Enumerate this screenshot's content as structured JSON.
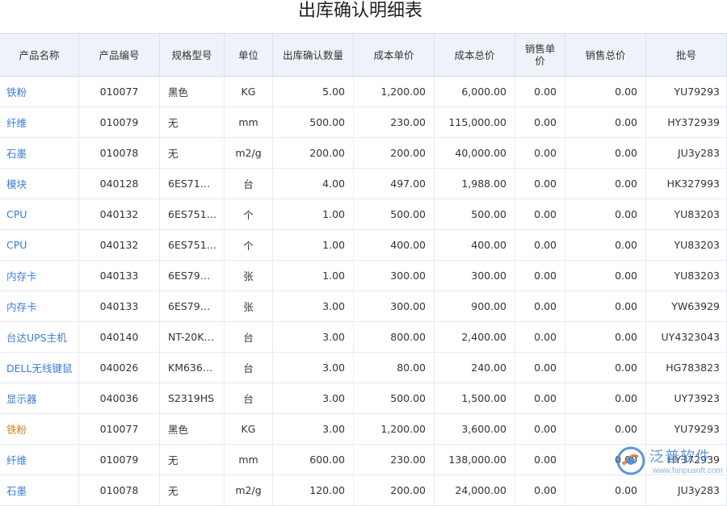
{
  "title": "出库确认明细表",
  "headers": {
    "name": "产品名称",
    "code": "产品编号",
    "spec": "规格型号",
    "unit": "单位",
    "qty": "出库确认数量",
    "unit_cost": "成本单价",
    "total_cost": "成本总价",
    "sale_price": "销售单价",
    "sale_total": "销售总价",
    "batch": "批号"
  },
  "rows": [
    {
      "name": "铁粉",
      "code": "010077",
      "spec": "黑色",
      "unit": "KG",
      "qty": "5.00",
      "unit_cost": "1,200.00",
      "total_cost": "6,000.00",
      "sale_price": "0.00",
      "sale_total": "0.00",
      "batch": "YU79293"
    },
    {
      "name": "纤维",
      "code": "010079",
      "spec": "无",
      "unit": "mm",
      "qty": "500.00",
      "unit_cost": "230.00",
      "total_cost": "115,000.00",
      "sale_price": "0.00",
      "sale_total": "0.00",
      "batch": "HY372939"
    },
    {
      "name": "石墨",
      "code": "010078",
      "spec": "无",
      "unit": "m2/g",
      "qty": "200.00",
      "unit_cost": "200.00",
      "total_cost": "40,000.00",
      "sale_price": "0.00",
      "sale_total": "0.00",
      "batch": "JU3y283"
    },
    {
      "name": "模块",
      "code": "040128",
      "spec": "6ES71…",
      "unit": "台",
      "qty": "4.00",
      "unit_cost": "497.00",
      "total_cost": "1,988.00",
      "sale_price": "0.00",
      "sale_total": "0.00",
      "batch": "HK327993"
    },
    {
      "name": "CPU",
      "code": "040132",
      "spec": "6ES751…",
      "unit": "个",
      "qty": "1.00",
      "unit_cost": "500.00",
      "total_cost": "500.00",
      "sale_price": "0.00",
      "sale_total": "0.00",
      "batch": "YU83203"
    },
    {
      "name": "CPU",
      "code": "040132",
      "spec": "6ES751…",
      "unit": "个",
      "qty": "1.00",
      "unit_cost": "400.00",
      "total_cost": "400.00",
      "sale_price": "0.00",
      "sale_total": "0.00",
      "batch": "YU83203"
    },
    {
      "name": "内存卡",
      "code": "040133",
      "spec": "6ES79…",
      "unit": "张",
      "qty": "1.00",
      "unit_cost": "300.00",
      "total_cost": "300.00",
      "sale_price": "0.00",
      "sale_total": "0.00",
      "batch": "YU83203"
    },
    {
      "name": "内存卡",
      "code": "040133",
      "spec": "6ES79…",
      "unit": "张",
      "qty": "3.00",
      "unit_cost": "300.00",
      "total_cost": "900.00",
      "sale_price": "0.00",
      "sale_total": "0.00",
      "batch": "YW63929"
    },
    {
      "name": "台达UPS主机",
      "code": "040140",
      "spec": "NT-20K…",
      "unit": "台",
      "qty": "3.00",
      "unit_cost": "800.00",
      "total_cost": "2,400.00",
      "sale_price": "0.00",
      "sale_total": "0.00",
      "batch": "UY4323043"
    },
    {
      "name": "DELL无线键鼠",
      "code": "040026",
      "spec": "KM636…",
      "unit": "台",
      "qty": "3.00",
      "unit_cost": "80.00",
      "total_cost": "240.00",
      "sale_price": "0.00",
      "sale_total": "0.00",
      "batch": "HG783823"
    },
    {
      "name": "显示器",
      "code": "040036",
      "spec": "S2319HS",
      "unit": "台",
      "qty": "3.00",
      "unit_cost": "500.00",
      "total_cost": "1,500.00",
      "sale_price": "0.00",
      "sale_total": "0.00",
      "batch": "UY73923"
    },
    {
      "name": "铁粉",
      "code": "010077",
      "spec": "黑色",
      "unit": "KG",
      "qty": "3.00",
      "unit_cost": "1,200.00",
      "total_cost": "3,600.00",
      "sale_price": "0.00",
      "sale_total": "0.00",
      "batch": "YU79293",
      "highlight": true
    },
    {
      "name": "纤维",
      "code": "010079",
      "spec": "无",
      "unit": "mm",
      "qty": "600.00",
      "unit_cost": "230.00",
      "total_cost": "138,000.00",
      "sale_price": "0.00",
      "sale_total": "0.00",
      "batch": "HY372939"
    },
    {
      "name": "石墨",
      "code": "010078",
      "spec": "无",
      "unit": "m2/g",
      "qty": "120.00",
      "unit_cost": "200.00",
      "total_cost": "24,000.00",
      "sale_price": "0.00",
      "sale_total": "0.00",
      "batch": "JU3y283"
    }
  ],
  "watermark": {
    "brand": "泛普软件",
    "url": "www.fanpusoft.com"
  },
  "colors": {
    "link": "#3b7bd6",
    "highlight_link": "#e07b1f",
    "header_bg": "#eef3fa",
    "watermark": "#4a8ad8"
  }
}
